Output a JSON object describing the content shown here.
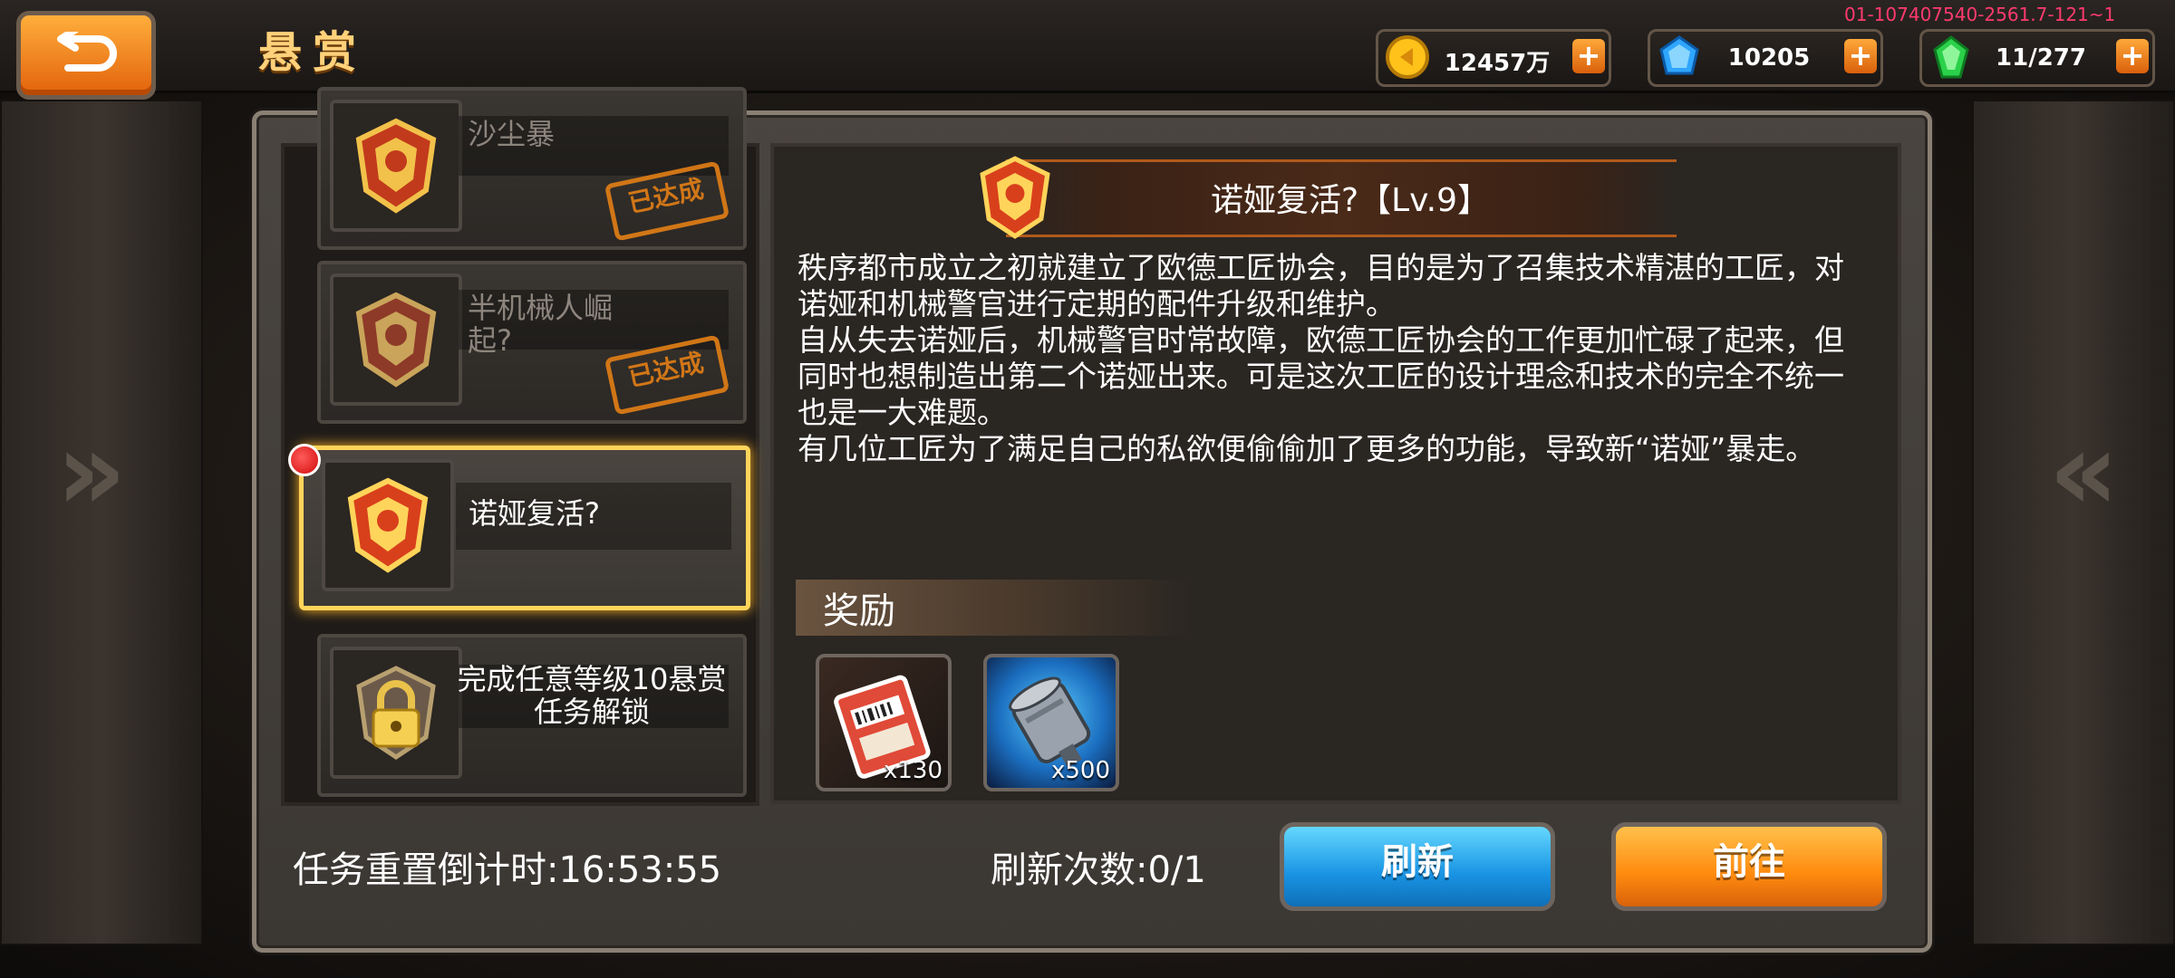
{
  "header": {
    "title": "悬赏",
    "debug_code": "01-107407540-2561.7-121~1",
    "resources": [
      {
        "name": "gold",
        "value": "12457万",
        "icon": "gold-coin-icon"
      },
      {
        "name": "diamond",
        "value": "10205",
        "icon": "blue-gem-icon"
      },
      {
        "name": "energy",
        "value": "11/277",
        "icon": "green-crystal-icon"
      }
    ]
  },
  "tasks": [
    {
      "name": "沙尘暴",
      "status_stamp": "已达成"
    },
    {
      "name": "半机械人崛起?",
      "status_stamp": "已达成"
    },
    {
      "name": "诺娅复活?",
      "selected": true
    },
    {
      "name": "完成任意等级10悬赏任务解锁",
      "locked": true
    }
  ],
  "detail": {
    "title": "诺娅复活?【Lv.9】",
    "paragraphs": [
      "秩序都市成立之初就建立了欧德工匠协会，目的是为了召集技术精湛的工匠，对诺娅和机械警官进行定期的配件升级和维护。",
      "自从失去诺娅后，机械警官时常故障，欧德工匠协会的工作更加忙碌了起来，但同时也想制造出第二个诺娅出来。可是这次工匠的设计理念和技术的完全不统一也是一大难题。",
      "有几位工匠为了满足自己的私欲便偷偷加了更多的功能，导致新“诺娅”暴走。"
    ],
    "reward_title": "奖励",
    "rewards": [
      {
        "icon": "ticket-icon",
        "count": "x130"
      },
      {
        "icon": "motor-part-icon",
        "count": "x500"
      }
    ]
  },
  "footer": {
    "countdown": "任务重置倒计时:16:53:55",
    "refresh_count": "刷新次数:0/1",
    "refresh_label": "刷新",
    "go_label": "前往"
  },
  "colors": {
    "accent_gold": "#ffd45a",
    "stamp_orange": "#e37f16",
    "refresh_blue": "#1993e3",
    "go_orange": "#ff8a0e"
  }
}
